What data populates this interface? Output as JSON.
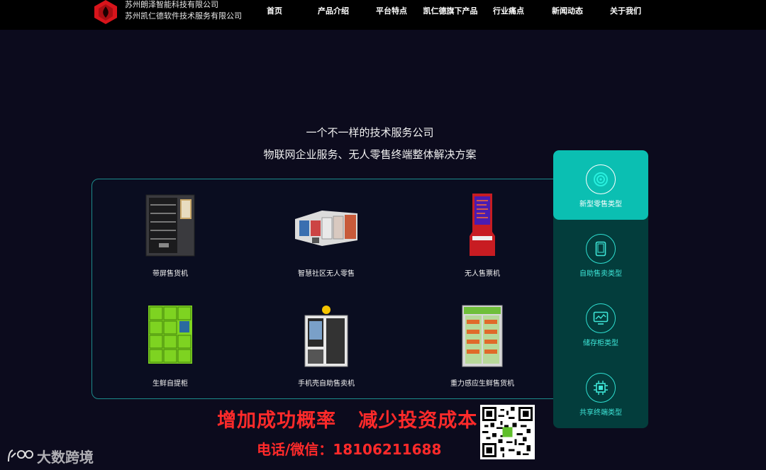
{
  "header": {
    "company_line1": "苏州朗泽智能科技有限公司",
    "company_line2": "苏州凯仁德软件技术服务有限公司",
    "nav": [
      {
        "label": "首页"
      },
      {
        "label": "产品介绍"
      },
      {
        "label": "平台特点"
      },
      {
        "label": "凯仁德旗下产品"
      },
      {
        "label": "行业痛点"
      },
      {
        "label": "新闻动态"
      },
      {
        "label": "关于我们"
      }
    ]
  },
  "hero": {
    "slogan1": "一个不一样的技术服务公司",
    "slogan2": "物联网企业服务、无人零售终端整体解决方案"
  },
  "products": [
    {
      "label": "带屏售货机"
    },
    {
      "label": "智慧社区无人零售"
    },
    {
      "label": "无人售票机"
    },
    {
      "label": "生鲜自提柜"
    },
    {
      "label": "手机壳自助售卖机"
    },
    {
      "label": "重力感应生鲜售货机"
    }
  ],
  "side_menu": [
    {
      "label": "新型零售类型",
      "icon": "target-icon",
      "active": true
    },
    {
      "label": "自助售卖类型",
      "icon": "tablet-icon",
      "active": false
    },
    {
      "label": "储存柜类型",
      "icon": "monitor-chart-icon",
      "active": false
    },
    {
      "label": "共享终端类型",
      "icon": "chip-icon",
      "active": false
    }
  ],
  "promo": {
    "line1": "增加成功概率   减少投资成本",
    "line2": "电话/微信：18106211688"
  },
  "watermark": {
    "text": "大数跨境"
  },
  "colors": {
    "background": "#0c0b1d",
    "side_active": "#0bbfb2",
    "side_bg": "#033d3c",
    "promo_red": "#ff2a2a",
    "panel_border": "#1c8c8c"
  }
}
